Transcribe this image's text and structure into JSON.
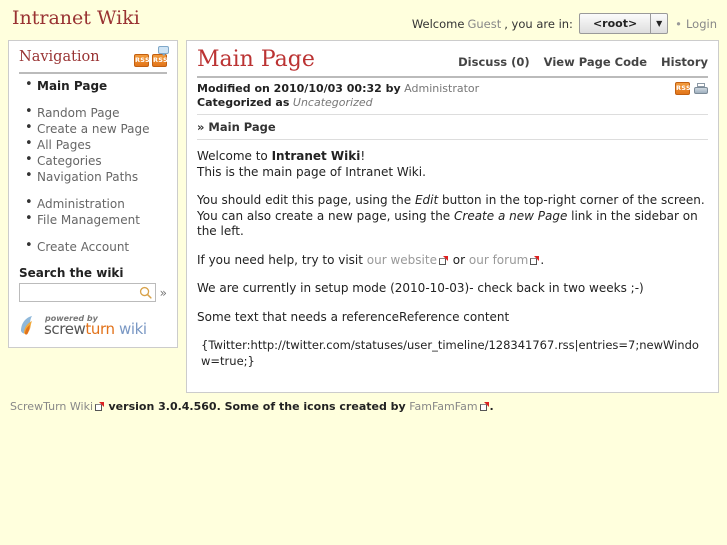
{
  "header": {
    "site_title": "Intranet Wiki",
    "welcome_word": "Welcome",
    "user_name": "Guest",
    "you_are_in": ", you are in:",
    "namespace_value": "<root>",
    "namespace_arrow": "▼",
    "separator": "•",
    "login_label": "Login"
  },
  "sidebar": {
    "title": "Navigation",
    "rss_label": "RSS",
    "rss_label_2": "RSS",
    "items_primary": [
      {
        "label": "Main Page",
        "current": true
      }
    ],
    "items_secondary": [
      {
        "label": "Random Page"
      },
      {
        "label": "Create a new Page"
      },
      {
        "label": "All Pages"
      },
      {
        "label": "Categories"
      },
      {
        "label": "Navigation Paths"
      }
    ],
    "items_admin": [
      {
        "label": "Administration"
      },
      {
        "label": "File Management"
      }
    ],
    "items_account": [
      {
        "label": "Create Account"
      }
    ],
    "search_label": "Search the wiki",
    "search_value": "",
    "search_placeholder": "",
    "search_go": "»",
    "powered_small": "powered by",
    "powered_word_1": "screw",
    "powered_word_2": "turn",
    "powered_word_3": "wiki"
  },
  "content": {
    "page_title": "Main Page",
    "actions": [
      {
        "label": "Discuss (0)"
      },
      {
        "label": "View Page Code"
      },
      {
        "label": "History"
      }
    ],
    "meta_modified_prefix": "Modified on 2010/10/03 00:32 by",
    "meta_modified_user": "Administrator",
    "meta_categorized_prefix": "Categorized as",
    "meta_categorized_value": "Uncategorized",
    "meta_rss_label": "RSS",
    "breadcrumb": "» Main Page",
    "para1_a": "Welcome to ",
    "para1_b": "Intranet Wiki",
    "para1_c": "!",
    "para1_line2": "This is the main page of Intranet Wiki.",
    "para2_a": "You should edit this page, using the ",
    "para2_em1": "Edit",
    "para2_b": " button in the top-right corner of the screen. You can also create a new page, using the ",
    "para2_em2": "Create a new Page",
    "para2_c": " link in the sidebar on the left.",
    "para3_a": "If you need help, try to visit ",
    "para3_link1": "our website",
    "para3_b": " or ",
    "para3_link2": "our forum",
    "para3_c": ".",
    "para4": "We are currently in setup mode (2010-10-03)- check back in two weeks ;-)",
    "para5": "Some text that needs a referenceReference content",
    "para6": "{Twitter:http://twitter.com/statuses/user_timeline/128341767.rss|entries=7;newWindow=true;}"
  },
  "footer": {
    "product_link": "ScrewTurn Wiki",
    "version_text": "version 3.0.4.560. Some of the icons created by",
    "credit_link": "FamFamFam",
    "period": "."
  },
  "colors": {
    "page_background": "#ffffdd",
    "panel_background": "#ffffff",
    "panel_border": "#cccccc",
    "heading_red": "#993333",
    "title_red": "#bb3333",
    "muted_text": "#888888",
    "rss_orange": "#e2751a",
    "link_blue": "#7a98c4"
  }
}
